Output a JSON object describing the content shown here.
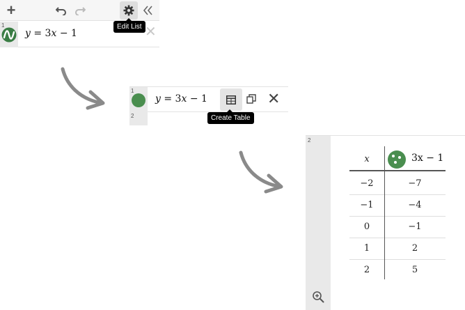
{
  "panel1": {
    "toolbar": {
      "add_icon": "plus-icon",
      "undo_icon": "undo-icon",
      "redo_icon": "redo-icon",
      "settings_icon": "gear-icon",
      "collapse_icon": "double-chevron-left-icon"
    },
    "tooltip": "Edit List",
    "expression": {
      "row_number": "1",
      "icon": "desmos-logo-icon",
      "lhs": "y",
      "equals": " = 3",
      "var": "x",
      "rest": " − 1"
    }
  },
  "panel2": {
    "row1": {
      "row_number": "1",
      "color": "#4a8e4f",
      "lhs": "y",
      "equals": " = 3",
      "var": "x",
      "rest": " − 1"
    },
    "row2_number": "2",
    "tooltip": "Create Table"
  },
  "panel3": {
    "row_number": "2",
    "table": {
      "header_x": "x",
      "header_y": "3x − 1",
      "rows": [
        {
          "x": "−2",
          "y": "−7"
        },
        {
          "x": "−1",
          "y": "−4"
        },
        {
          "x": "0",
          "y": "−1"
        },
        {
          "x": "1",
          "y": "2"
        },
        {
          "x": "2",
          "y": "5"
        }
      ]
    }
  },
  "colors": {
    "series_green": "#4a8e4f",
    "arrow_gray": "#8a8a8a"
  }
}
